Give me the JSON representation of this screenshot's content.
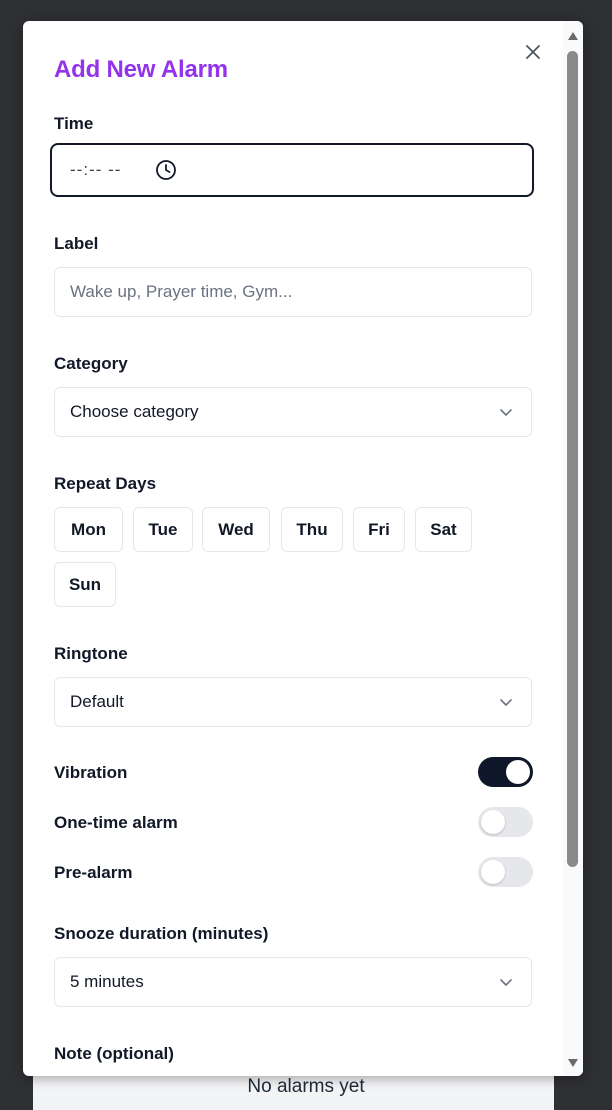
{
  "background": {
    "empty_state_text": "No alarms yet"
  },
  "modal": {
    "title": "Add New Alarm",
    "close_icon": "close-icon",
    "time": {
      "label": "Time",
      "value": "--:-- --",
      "icon": "clock-icon"
    },
    "label_field": {
      "label": "Label",
      "placeholder": "Wake up, Prayer time, Gym..."
    },
    "category": {
      "label": "Category",
      "selected": "Choose category"
    },
    "repeat_days": {
      "label": "Repeat Days",
      "days": [
        "Mon",
        "Tue",
        "Wed",
        "Thu",
        "Fri",
        "Sat",
        "Sun"
      ]
    },
    "ringtone": {
      "label": "Ringtone",
      "selected": "Default"
    },
    "toggles": {
      "vibration": {
        "label": "Vibration",
        "on": true
      },
      "one_time": {
        "label": "One-time alarm",
        "on": false
      },
      "pre_alarm": {
        "label": "Pre-alarm",
        "on": false
      }
    },
    "snooze": {
      "label": "Snooze duration (minutes)",
      "selected": "5 minutes"
    },
    "note": {
      "label": "Note (optional)"
    }
  },
  "colors": {
    "title": "#9333ea",
    "toggle_on": "#0f172a",
    "toggle_off": "#e5e7eb",
    "backdrop": "#2f3033"
  }
}
